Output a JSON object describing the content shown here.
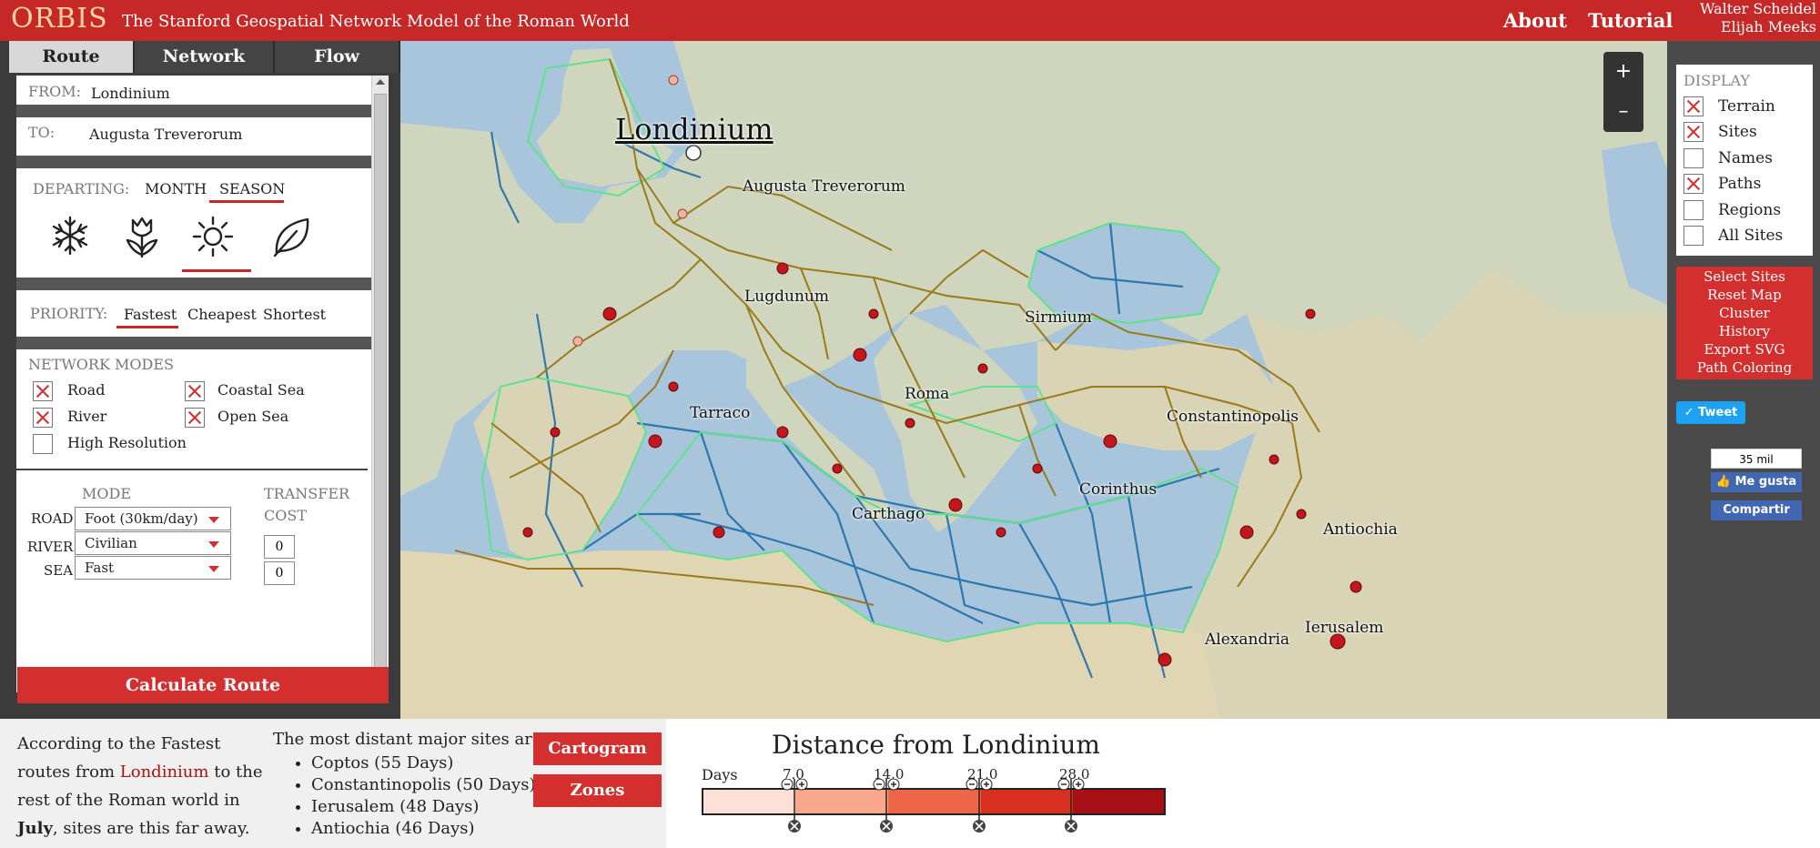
{
  "header": {
    "brand": "ORBIS",
    "subtitle": "The Stanford Geospatial Network Model of the Roman World",
    "nav": [
      "About",
      "Tutorial"
    ],
    "authors": [
      "Walter Scheidel",
      "Elijah Meeks"
    ]
  },
  "tabs": [
    "Route",
    "Network",
    "Flow"
  ],
  "route": {
    "from_label": "FROM:",
    "from_value": "Londinium",
    "to_label": "TO:",
    "to_value": "Augusta Treverorum",
    "departing_label": "DEPARTING:",
    "departing_options": [
      "MONTH",
      "SEASON"
    ],
    "seasons": [
      "snowflake-icon",
      "tulip-icon",
      "sun-icon",
      "leaf-icon"
    ],
    "priority_label": "PRIORITY:",
    "priority_options": [
      "Fastest",
      "Cheapest",
      "Shortest"
    ],
    "network_modes_label": "NETWORK MODES",
    "modes": [
      {
        "label": "Road",
        "checked": true
      },
      {
        "label": "Coastal Sea",
        "checked": true
      },
      {
        "label": "River",
        "checked": true
      },
      {
        "label": "Open Sea",
        "checked": true
      },
      {
        "label": "High Resolution",
        "checked": false
      }
    ],
    "mode_header": "MODE",
    "transfer_header_1": "TRANSFER",
    "transfer_header_2": "COST",
    "road_label": "ROAD",
    "road_value": "Foot (30km/day)",
    "river_label": "RIVER",
    "river_value": "Civilian",
    "sea_label": "SEA",
    "sea_value": "Fast",
    "transfer_values": [
      "0",
      "0"
    ],
    "calculate": "Calculate Route"
  },
  "map": {
    "zoom_in": "+",
    "zoom_out": "–",
    "labels": [
      "Londinium",
      "Augusta Treverorum",
      "Lugdunum",
      "Sirmium",
      "Tarraco",
      "Roma",
      "Constantinopolis",
      "Corinthus",
      "Carthago",
      "Antiochia",
      "Alexandria",
      "Ierusalem"
    ]
  },
  "display": {
    "title": "DISPLAY",
    "items": [
      {
        "label": "Terrain",
        "checked": true
      },
      {
        "label": "Sites",
        "checked": true
      },
      {
        "label": "Names",
        "checked": false
      },
      {
        "label": "Paths",
        "checked": true
      },
      {
        "label": "Regions",
        "checked": false
      },
      {
        "label": "All Sites",
        "checked": false
      }
    ]
  },
  "actions": [
    "Select Sites",
    "Reset Map",
    "Cluster",
    "History",
    "Export SVG",
    "Path Coloring"
  ],
  "social": {
    "tweet": "Tweet",
    "fb_count": "35 mil",
    "fb_like": "Me gusta",
    "fb_share": "Compartir"
  },
  "bottom": {
    "summary_1": "According to the Fastest routes from",
    "summary_site": "Londinium",
    "summary_2": "to the rest of the Roman world in",
    "summary_month": "July",
    "summary_3": ", sites are this far away.",
    "distant_title": "The most distant major sites are:",
    "distant": [
      "Coptos (55 Days)",
      "Constantinopolis (50 Days)",
      "Ierusalem (48 Days)",
      "Antiochia (46 Days)"
    ],
    "cartogram": "Cartogram",
    "zones": "Zones",
    "legend_title": "Distance from Londinium",
    "legend_days": "Days",
    "legend_breaks": [
      "7.0",
      "14.0",
      "21.0",
      "28.0"
    ],
    "legend_colors": [
      "#fde0d8",
      "#f9a88e",
      "#ef6548",
      "#d7301f",
      "#a50f15"
    ]
  }
}
